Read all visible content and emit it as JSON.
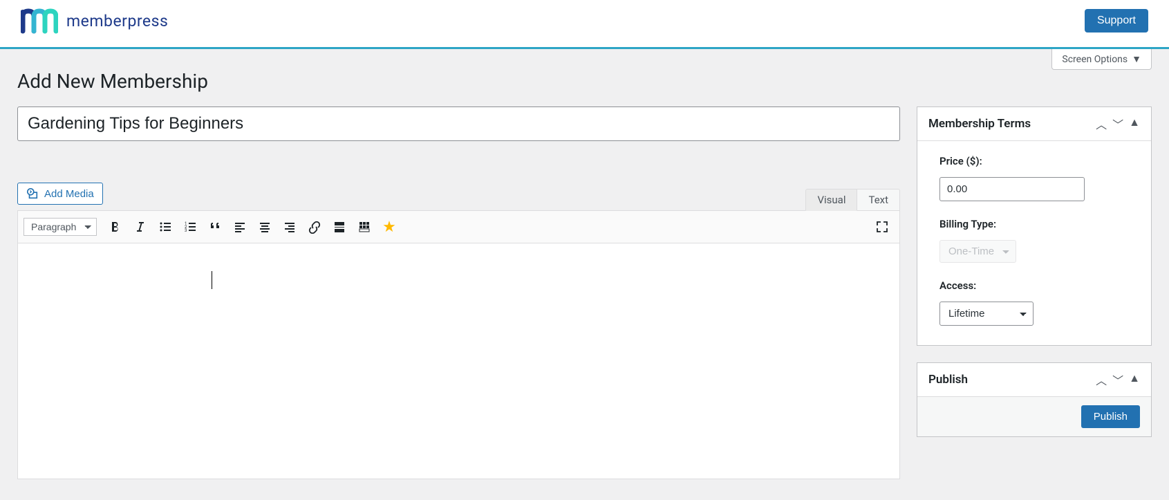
{
  "header": {
    "brand": "memberpress",
    "support_label": "Support"
  },
  "screen_options_label": "Screen Options",
  "page_title": "Add New Membership",
  "title_input_value": "Gardening Tips for Beginners",
  "add_media_label": "Add Media",
  "editor": {
    "tabs": {
      "visual": "Visual",
      "text": "Text"
    },
    "paragraph_label": "Paragraph"
  },
  "sidebar": {
    "terms": {
      "title": "Membership Terms",
      "price_label": "Price ($):",
      "price_value": "0.00",
      "billing_label": "Billing Type:",
      "billing_value": "One-Time",
      "access_label": "Access:",
      "access_value": "Lifetime"
    },
    "publish": {
      "title": "Publish",
      "button": "Publish"
    }
  }
}
